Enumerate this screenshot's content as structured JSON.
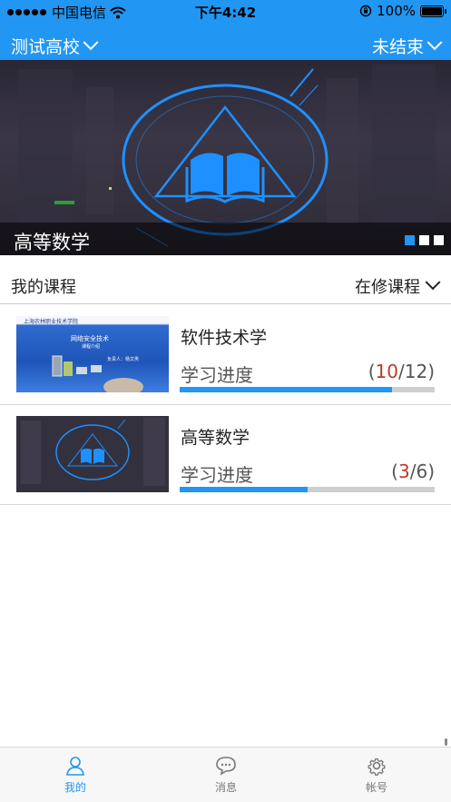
{
  "status_bar": {
    "carrier": "中国电信",
    "time": "下午4:42",
    "battery": "100%"
  },
  "nav": {
    "school": "测试高校",
    "state": "未结束"
  },
  "banner": {
    "title": "高等数学",
    "page_count": 3,
    "active_page": 1
  },
  "section": {
    "title": "我的课程",
    "filter": "在修课程"
  },
  "courses": [
    {
      "name": "软件技术学",
      "progress_label": "学习进度",
      "done": "10",
      "total": "12",
      "progress": 0.833,
      "thumb_text": {
        "school": "上海农林职业技术学院",
        "title": "网络安全技术",
        "subtitle": "课程介绍",
        "lecturer": "负责人：杨文男"
      }
    },
    {
      "name": "高等数学",
      "progress_label": "学习进度",
      "done": "3",
      "total": "6",
      "progress": 0.5
    }
  ],
  "tabs": [
    {
      "label": "我的",
      "icon": "person-icon",
      "active": true
    },
    {
      "label": "消息",
      "icon": "chat-bubble-icon",
      "active": false
    },
    {
      "label": "帐号",
      "icon": "gear-icon",
      "active": false
    }
  ],
  "colors": {
    "accent": "#2196f3",
    "progress_done": "#c0392b",
    "track": "#cfcfcf"
  }
}
